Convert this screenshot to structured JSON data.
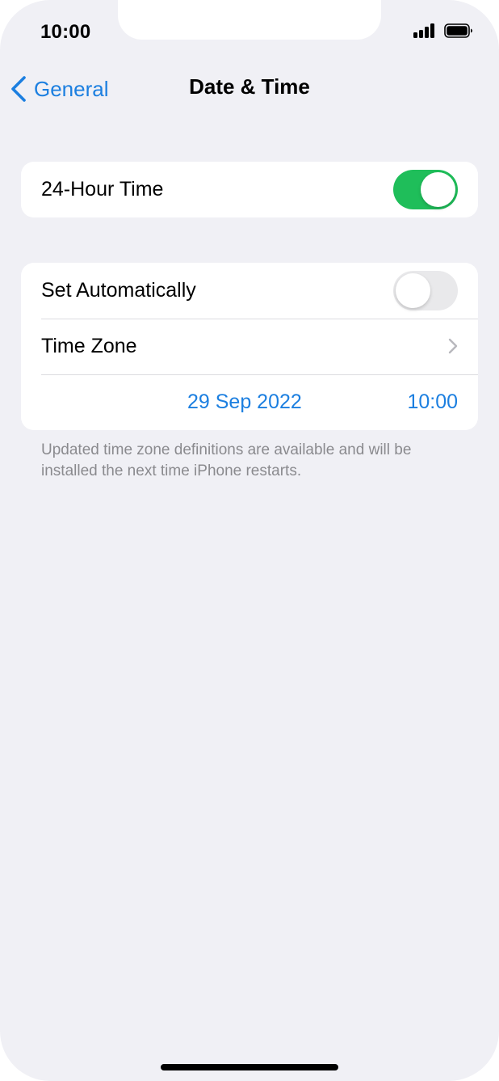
{
  "status_bar": {
    "time": "10:00",
    "signal_icon": "cellular-signal-icon",
    "battery_icon": "battery-full-icon"
  },
  "nav": {
    "back_icon": "chevron-left-icon",
    "back_label": "General",
    "title": "Date & Time"
  },
  "settings": {
    "hour24": {
      "label": "24-Hour Time",
      "enabled": true
    },
    "set_automatically": {
      "label": "Set Automatically",
      "enabled": false
    },
    "time_zone": {
      "label": "Time Zone",
      "chevron_icon": "chevron-right-icon"
    },
    "date_time": {
      "date": "29 Sep 2022",
      "time": "10:00"
    }
  },
  "footnote": "Updated time zone definitions are available and will be installed the next time iPhone restarts.",
  "colors": {
    "accent_blue": "#1c7fe0",
    "toggle_on_green": "#1fbe5a",
    "toggle_off_gray": "#e9e9eb",
    "background": "#f0f0f5"
  }
}
